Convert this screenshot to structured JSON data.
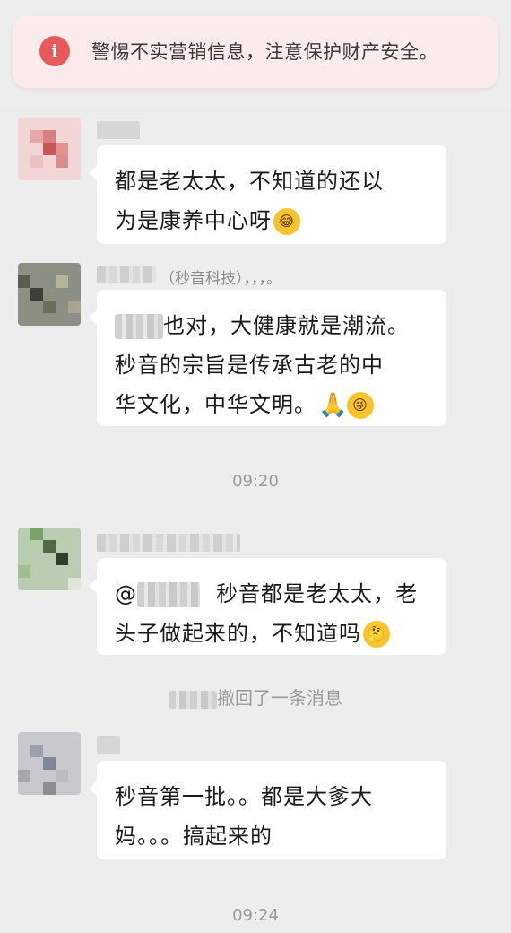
{
  "warning": {
    "icon": "i",
    "text": "警惕不实营销信息，注意保护财产安全。"
  },
  "messages": [
    {
      "sender_suffix": "",
      "lines": [
        "都是老太太，不知道的还以",
        "为是康养中心呀"
      ],
      "emoji": "laughing-crying-emoji"
    },
    {
      "sender_suffix": "（秒音科技），，，。",
      "lines": [
        "也对，大健康就是潮流。",
        "秒音的宗旨是传承古老的中",
        "华文化，中华文明。"
      ],
      "emoji": "praying-hands-and-wink-emoji"
    },
    {
      "sender_suffix": "",
      "lines": [
        "秒音都是老太太，老",
        "头子做起来的，不知道吗"
      ],
      "emoji": "thinking-emoji"
    },
    {
      "sender_suffix": "",
      "lines": [
        "秒音第一批。。都是大爹大",
        "妈。。。搞起来的"
      ],
      "emoji": ""
    }
  ],
  "timestamps": [
    "09:20",
    "09:24"
  ],
  "recall_text": "撤回了一条消息",
  "mention_prefix": "@",
  "emoji_glyphs": {
    "laugh": "😂",
    "pray": "🙏",
    "wink": "😜",
    "think": "🤔"
  }
}
